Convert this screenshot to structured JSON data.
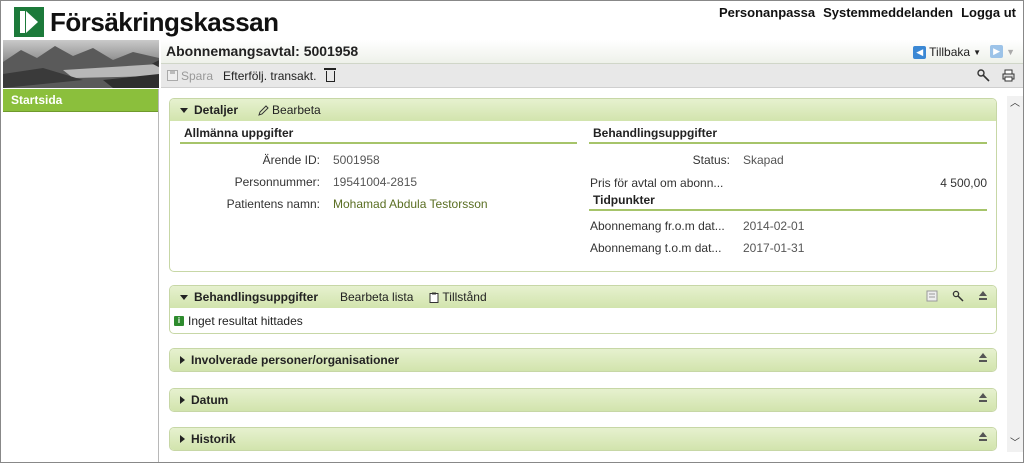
{
  "header": {
    "logo_text": "Försäkringskassan",
    "links": [
      "Personanpassa",
      "Systemmeddelanden",
      "Logga ut"
    ]
  },
  "sidebar": {
    "items": [
      {
        "label": "Startsida",
        "active": true
      }
    ]
  },
  "page": {
    "title": "Abonnemangsavtal: 5001958",
    "back_label": "Tillbaka"
  },
  "toolbar": {
    "save_label": "Spara",
    "followup_label": "Efterfölj. transakt."
  },
  "details_panel": {
    "title": "Detaljer",
    "edit_label": "Bearbeta",
    "general": {
      "heading": "Allmänna uppgifter",
      "fields": [
        {
          "label": "Ärende ID:",
          "value": "5001958"
        },
        {
          "label": "Personnummer:",
          "value": "19541004-2815"
        },
        {
          "label": "Patientens namn:",
          "value": "Mohamad Abdula Testorsson"
        }
      ]
    },
    "treatment": {
      "heading": "Behandlingsuppgifter",
      "status_label": "Status:",
      "status_value": "Skapad",
      "price_label": "Pris för avtal om abonn...",
      "price_value": "4 500,00"
    },
    "timepoints": {
      "heading": "Tidpunkter",
      "from_label": "Abonnemang fr.o.m dat...",
      "from_value": "2014-02-01",
      "to_label": "Abonnemang t.o.m dat...",
      "to_value": "2017-01-31"
    }
  },
  "treatment_panel": {
    "title": "Behandlingsuppgifter",
    "edit_list_label": "Bearbeta lista",
    "permit_label": "Tillstånd",
    "empty_message": "Inget resultat hittades"
  },
  "collapsed_panels": [
    {
      "title": "Involverade personer/organisationer"
    },
    {
      "title": "Datum"
    },
    {
      "title": "Historik"
    }
  ],
  "colors": {
    "accent_green": "#8bbf3c",
    "panel_header": "#d9e8bb",
    "logo_green": "#1c7a3a",
    "link_green": "#5a6e22"
  }
}
